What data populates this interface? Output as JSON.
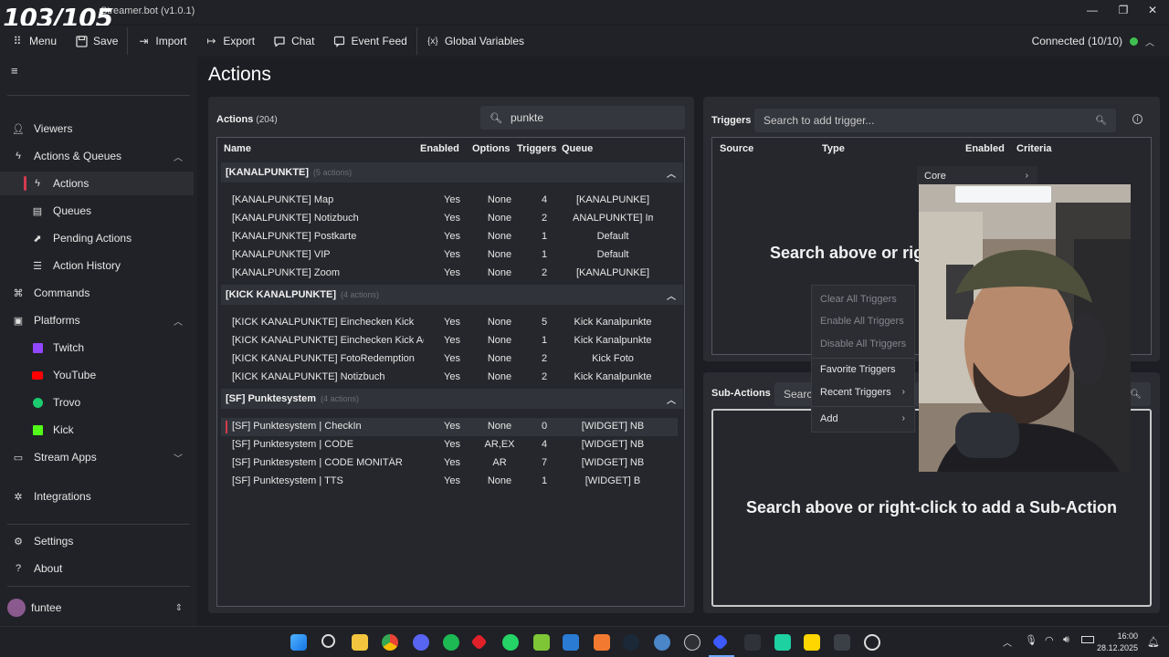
{
  "overlay": {
    "counter": "103/105"
  },
  "window": {
    "title": "Streamer.bot (v1.0.1)",
    "minimize": "—",
    "maximize": "❐",
    "close": "✕"
  },
  "toolbar": {
    "items": [
      {
        "label": "Menu",
        "icon": "grid-icon"
      },
      {
        "label": "Save",
        "icon": "save-icon"
      },
      {
        "label": "Import",
        "icon": "import-icon"
      },
      {
        "label": "Export",
        "icon": "export-icon"
      },
      {
        "label": "Chat",
        "icon": "chat-icon"
      },
      {
        "label": "Event Feed",
        "icon": "feed-icon"
      },
      {
        "label": "Global Variables",
        "icon": "variables-icon"
      }
    ],
    "connection": "Connected (10/10)",
    "status_color": "#3fbf4f"
  },
  "sidebar": {
    "items": [
      {
        "label": "Viewers",
        "icon": "person-icon"
      },
      {
        "label": "Actions & Queues",
        "icon": "bolt-icon"
      },
      {
        "label": "Actions",
        "icon": "bolt-icon"
      },
      {
        "label": "Queues",
        "icon": "queue-icon"
      },
      {
        "label": "Pending Actions",
        "icon": "pending-icon"
      },
      {
        "label": "Action History",
        "icon": "history-icon"
      },
      {
        "label": "Commands",
        "icon": "command-icon"
      },
      {
        "label": "Platforms",
        "icon": "platforms-icon"
      },
      {
        "label": "Twitch",
        "icon": "twitch-icon"
      },
      {
        "label": "YouTube",
        "icon": "youtube-icon"
      },
      {
        "label": "Trovo",
        "icon": "trovo-icon"
      },
      {
        "label": "Kick",
        "icon": "kick-icon"
      },
      {
        "label": "Stream Apps",
        "icon": "apps-icon"
      },
      {
        "label": "Integrations",
        "icon": "integrations-icon"
      },
      {
        "label": "Settings",
        "icon": "gear-icon"
      },
      {
        "label": "About",
        "icon": "question-icon"
      }
    ],
    "user": "funtee"
  },
  "main": {
    "title": "Actions",
    "actions_panel": {
      "label": "Actions",
      "count": "(204)",
      "search_value": "punkte",
      "columns": [
        "Name",
        "Enabled",
        "Options",
        "Triggers",
        "Queue"
      ],
      "groups": [
        {
          "name": "[KANALPUNKTE]",
          "count": "(5 actions)",
          "rows": [
            [
              "[KANALPUNKTE] Map",
              "Yes",
              "None",
              "4",
              "[KANALPUNKE]"
            ],
            [
              "[KANALPUNKTE] Notizbuch",
              "Yes",
              "None",
              "2",
              "ANALPUNKTE] Imm"
            ],
            [
              "[KANALPUNKTE] Postkarte",
              "Yes",
              "None",
              "1",
              "Default"
            ],
            [
              "[KANALPUNKTE] VIP",
              "Yes",
              "None",
              "1",
              "Default"
            ],
            [
              "[KANALPUNKTE] Zoom",
              "Yes",
              "None",
              "2",
              "[KANALPUNKE]"
            ]
          ]
        },
        {
          "name": "[KICK KANALPUNKTE]",
          "count": "(4 actions)",
          "rows": [
            [
              "[KICK KANALPUNKTE] Einchecken Kick",
              "Yes",
              "None",
              "5",
              "Kick Kanalpunkte"
            ],
            [
              "[KICK KANALPUNKTE] Einchecken Kick Add",
              "Yes",
              "None",
              "1",
              "Kick Kanalpunkte"
            ],
            [
              "[KICK KANALPUNKTE] FotoRedemption",
              "Yes",
              "None",
              "2",
              "Kick Foto"
            ],
            [
              "[KICK KANALPUNKTE] Notizbuch",
              "Yes",
              "None",
              "2",
              "Kick Kanalpunkte"
            ]
          ]
        },
        {
          "name": "[SF] Punktesystem",
          "count": "(4 actions)",
          "rows": [
            [
              "[SF] Punktesystem | CheckIn",
              "Yes",
              "None",
              "0",
              "[WIDGET] NB"
            ],
            [
              "[SF] Punktesystem | CODE",
              "Yes",
              "AR,EX",
              "4",
              "[WIDGET] NB"
            ],
            [
              "[SF] Punktesystem | CODE MONITÄR",
              "Yes",
              "AR",
              "7",
              "[WIDGET] NB"
            ],
            [
              "[SF] Punktesystem | TTS",
              "Yes",
              "None",
              "1",
              "[WIDGET] B"
            ]
          ]
        }
      ]
    },
    "triggers_panel": {
      "label": "Triggers",
      "search_placeholder": "Search to add trigger...",
      "columns": [
        "Source",
        "Type",
        "Enabled",
        "Criteria"
      ],
      "empty_text": "Search above or rig"
    },
    "subactions_panel": {
      "label": "Sub-Actions",
      "search_placeholder": "Search",
      "empty_text": "Search above or right-click to add a Sub-Action"
    },
    "context_menu": {
      "core": "Core",
      "items": [
        {
          "label": "Clear All Triggers",
          "disabled": true
        },
        {
          "label": "Enable All Triggers",
          "disabled": true
        },
        {
          "label": "Disable All Triggers",
          "disabled": true
        },
        {
          "label": "Favorite Triggers",
          "disabled": false
        },
        {
          "label": "Recent Triggers",
          "disabled": false
        },
        {
          "label": "Add",
          "disabled": false
        }
      ]
    }
  },
  "taskbar": {
    "time": "16:00",
    "date": "28.12.2025"
  }
}
